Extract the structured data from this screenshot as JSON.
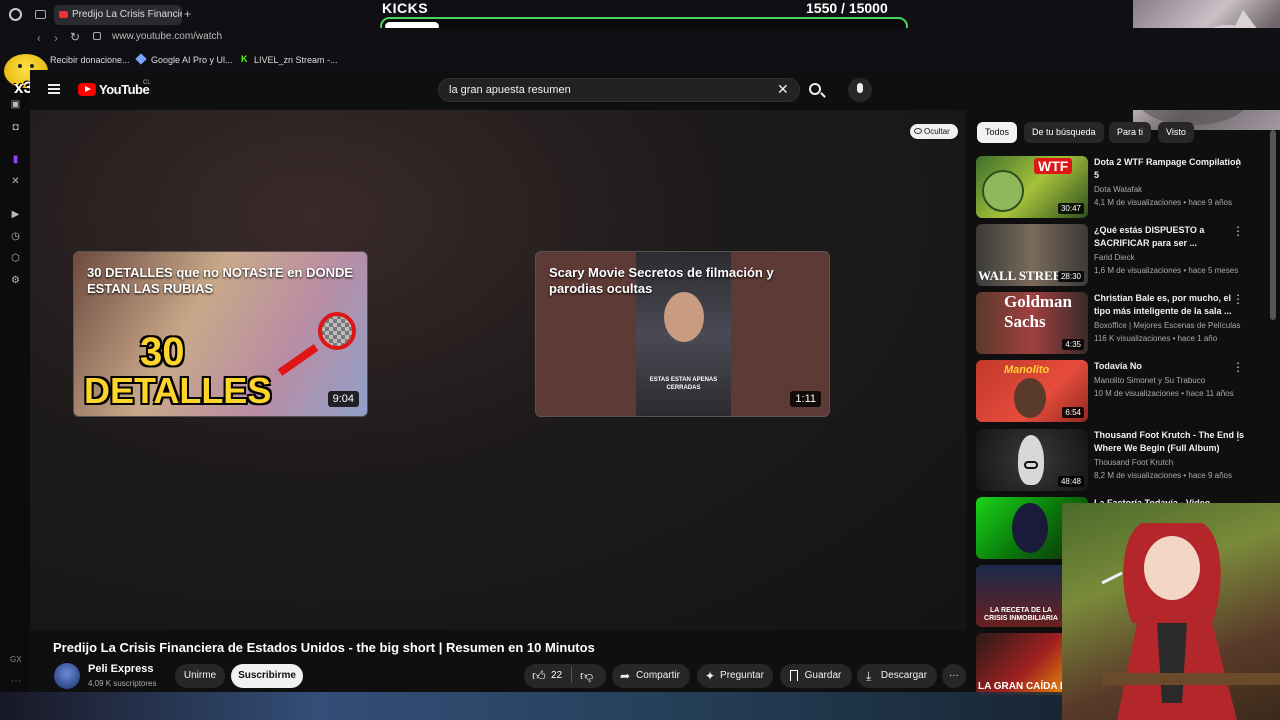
{
  "browser": {
    "tab_title": "Predijo La Crisis Financiera",
    "new_tab": "+",
    "url": "www.youtube.com/watch",
    "bookmarks": [
      "Recibir donacione...",
      "Google AI Pro y Ul...",
      "LIVEL_zn Stream -..."
    ],
    "sidebar_bottom_label": "GX"
  },
  "overlay": {
    "kicks_label": "KICKS",
    "kicks_count": "1550",
    "kicks_goal": "/ 15000",
    "kicks_progress": 0.1033,
    "multiplier": "x3"
  },
  "youtube": {
    "logo_text": "YouTube",
    "country": "CL",
    "search_value": "la gran apuesta resumen",
    "hide_label": "Ocultar",
    "end_cards": [
      {
        "title": "30 DETALLES que no NOTASTE en DONDE ESTAN LAS RUBIAS",
        "duration": "9:04",
        "thumb_text_1": "30",
        "thumb_text_2": "DETALLES"
      },
      {
        "title": "Scary Movie Secretos de filmación y parodias ocultas",
        "duration": "1:11",
        "subtitle": "ESTAS ESTAN APENAS CERRADAS"
      }
    ],
    "video_title": "Predijo La Crisis Financiera de Estados Unidos - the big short | Resumen en 10 Minutos",
    "channel": {
      "name": "Peli Express",
      "subscribers": "4,09 K suscriptores"
    },
    "buttons": {
      "join": "Unirme",
      "subscribe": "Suscribirme",
      "likes": "22",
      "share": "Compartir",
      "ask": "Preguntar",
      "save": "Guardar",
      "download": "Descargar",
      "more": "···"
    },
    "chips": [
      "Todos",
      "De tu búsqueda",
      "Para ti",
      "Visto"
    ],
    "recommendations": [
      {
        "title": "Dota 2 WTF Rampage Compilation 5",
        "channel": "Dota Watafak",
        "meta": "4,1 M de visualizaciones • hace 9 años",
        "duration": "30:47",
        "thumb_text": "WTF"
      },
      {
        "title": "¿Qué estás DISPUESTO a SACRIFICAR para ser ...",
        "channel": "Farid Dieck",
        "meta": "1,6 M de visualizaciones • hace 5 meses",
        "duration": "28:30",
        "thumb_text": "WALL STREET"
      },
      {
        "title": "Christian Bale es, por mucho, el tipo más inteligente de la sala ...",
        "channel": "Boxoffice | Mejores Escenas de Películas",
        "meta": "116 K visualizaciones • hace 1 año",
        "duration": "4:35",
        "thumb_text": "Goldman Sachs"
      },
      {
        "title": "Todavía No",
        "channel": "Manolito Simonet y Su Trabuco",
        "meta": "10 M de visualizaciones • hace 11 años",
        "duration": "6:54",
        "thumb_text": "Manolito"
      },
      {
        "title": "Thousand Foot Krutch - The End is Where We Begin (Full Album)",
        "channel": "Thousand Foot Krutch",
        "meta": "8,2 M de visualizaciones • hace 9 años",
        "duration": "48:48",
        "thumb_text": ""
      },
      {
        "title": "La Factoría Todavía - Video",
        "channel": "",
        "meta": "",
        "duration": "",
        "thumb_text": ""
      },
      {
        "title": "",
        "channel": "",
        "meta": "",
        "duration": "",
        "thumb_text": "LA RECETA DE LA CRISIS INMOBILIARIA"
      },
      {
        "title": "",
        "channel": "",
        "meta": "",
        "duration": "",
        "thumb_text": "LA GRAN CAÍDA EN"
      }
    ]
  },
  "colors": {
    "youtube_red": "#ff0000",
    "kicks_green": "#4ad25a",
    "background": "#0f0f0f"
  }
}
